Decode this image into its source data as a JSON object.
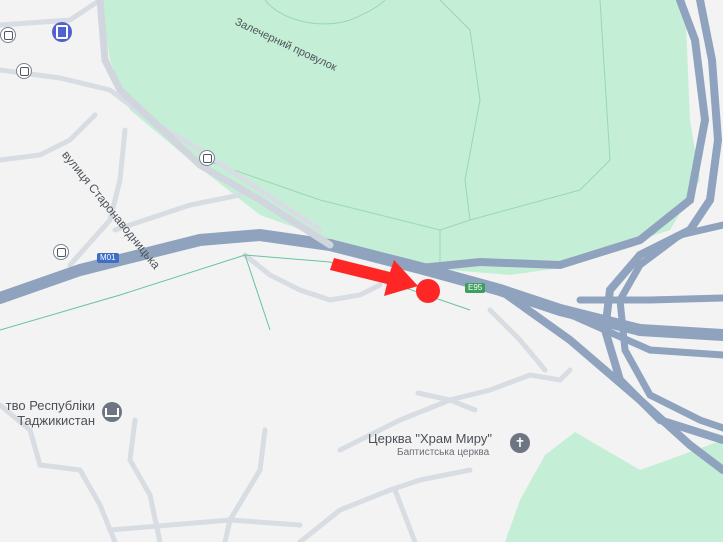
{
  "map": {
    "colors": {
      "background": "#f3f3f3",
      "park": "#c4efd6",
      "highway": "#8fa3bf",
      "highway_casing": "#7a8eab",
      "minor_road": "#d7dbe2",
      "marker": "#ff2626"
    },
    "labels": {
      "street_staronavodnytska": "вулиця Старонаводницька",
      "street_zalechernyi": "Залечерний провулок",
      "route_m01": "M01",
      "route_e95": "E95",
      "embassy": "тво Республіки\nТаджикистан",
      "church_name": "Церква \"Храм Миру\"",
      "church_type": "Баптистська церква"
    },
    "icons": {
      "fuel": "fuel-station-icon",
      "bus": "bus-stop-icon",
      "embassy": "embassy-icon",
      "church": "church-cross-icon",
      "marker": "location-marker-icon",
      "arrow": "pointer-arrow-icon"
    }
  }
}
